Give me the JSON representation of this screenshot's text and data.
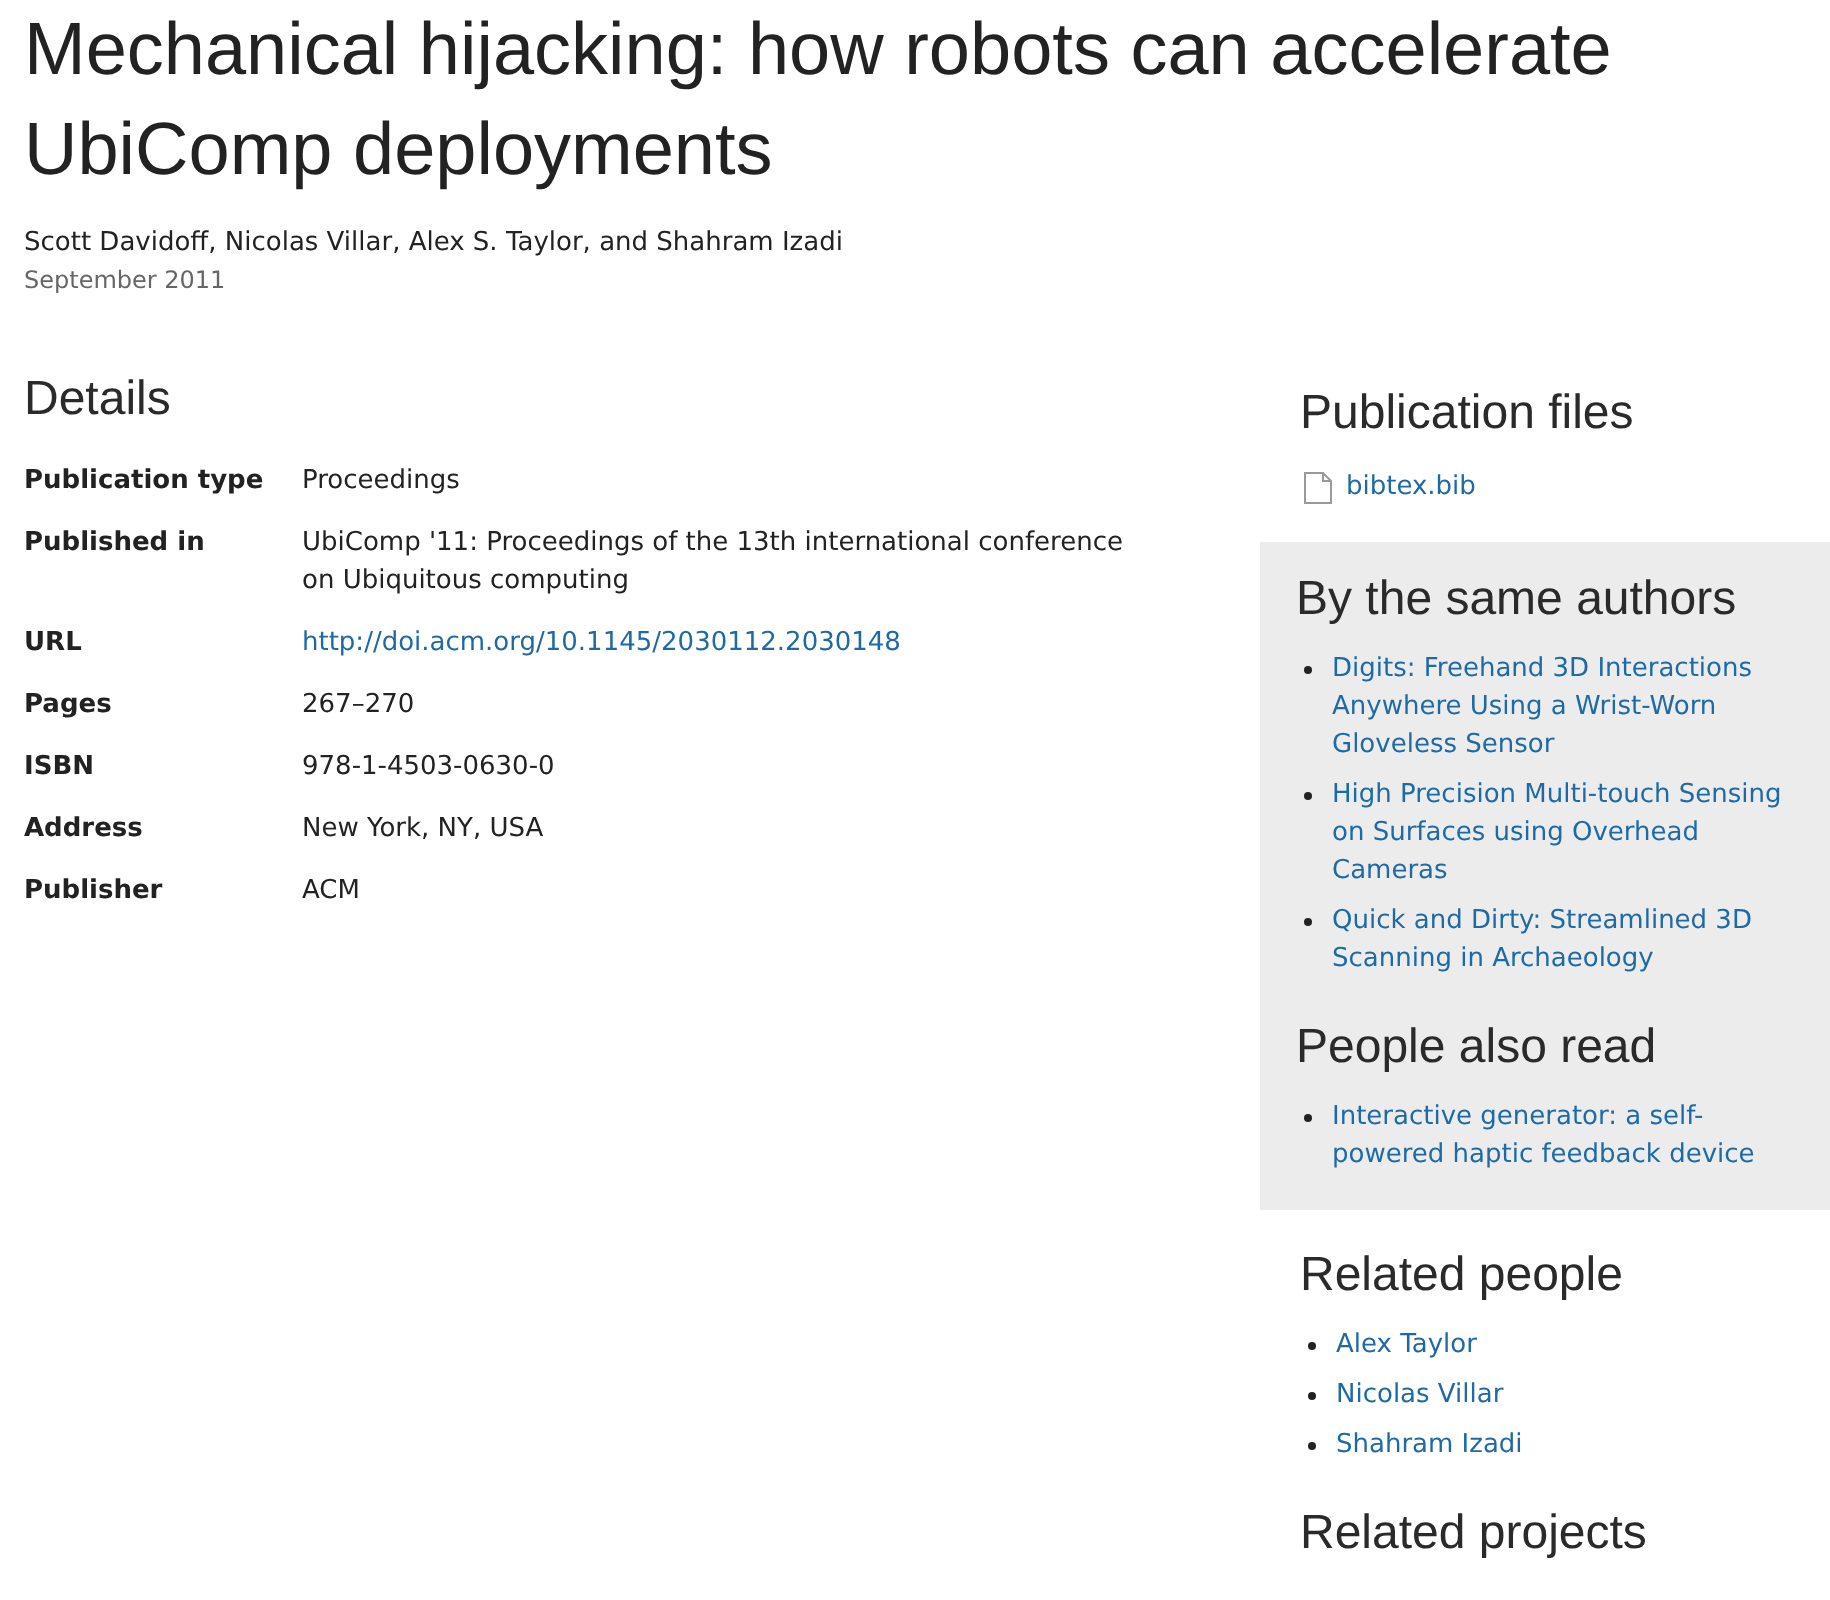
{
  "title": "Mechanical hijacking: how robots can accelerate UbiComp deployments",
  "authors": "Scott Davidoff, Nicolas Villar, Alex S. Taylor, and Shahram Izadi",
  "date": "September 2011",
  "details": {
    "heading": "Details",
    "rows": [
      {
        "label": "Publication type",
        "value": "Proceedings",
        "kind": "text"
      },
      {
        "label": "Published in",
        "value": "UbiComp '11: Proceedings of the 13th international conference on Ubiquitous computing",
        "kind": "text"
      },
      {
        "label": "URL",
        "value": "http://doi.acm.org/10.1145/2030112.2030148",
        "kind": "link"
      },
      {
        "label": "Pages",
        "value": "267–270",
        "kind": "text"
      },
      {
        "label": "ISBN",
        "value": "978-1-4503-0630-0",
        "kind": "text"
      },
      {
        "label": "Address",
        "value": "New York, NY, USA",
        "kind": "text"
      },
      {
        "label": "Publisher",
        "value": "ACM",
        "kind": "text"
      }
    ]
  },
  "sidebar": [
    {
      "kind": "files",
      "heading": "Publication files",
      "files": [
        "bibtex.bib"
      ]
    },
    {
      "kind": "panel",
      "groups": [
        {
          "heading": "By the same authors",
          "links": [
            "Digits: Freehand 3D Interactions Anywhere Using a Wrist-Worn Gloveless Sensor",
            "High Precision Multi-touch Sensing on Surfaces using Overhead Cameras",
            "Quick and Dirty: Streamlined 3D Scanning in Archaeology"
          ]
        },
        {
          "heading": "People also read",
          "links": [
            "Interactive generator: a self-powered haptic feedback device"
          ]
        }
      ]
    },
    {
      "kind": "links",
      "heading": "Related people",
      "links": [
        "Alex Taylor",
        "Nicolas Villar",
        "Shahram Izadi"
      ]
    },
    {
      "kind": "links",
      "heading": "Related projects"
    }
  ]
}
